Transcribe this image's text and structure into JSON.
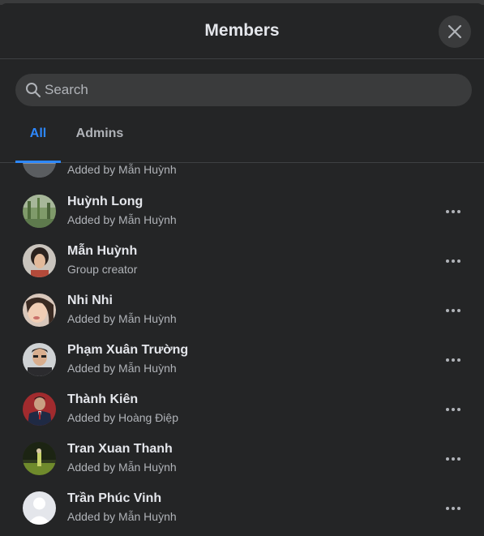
{
  "dialog": {
    "title": "Members"
  },
  "search": {
    "placeholder": "Search"
  },
  "tabs": [
    {
      "label": "All",
      "active": true
    },
    {
      "label": "Admins",
      "active": false
    }
  ],
  "members": [
    {
      "name": "",
      "subtitle": "Added by Mẫn Huỳnh"
    },
    {
      "name": "Huỳnh Long",
      "subtitle": "Added by Mẫn Huỳnh"
    },
    {
      "name": "Mẫn Huỳnh",
      "subtitle": "Group creator"
    },
    {
      "name": "Nhi Nhi",
      "subtitle": "Added by Mẫn Huỳnh"
    },
    {
      "name": "Phạm Xuân Trường",
      "subtitle": "Added by Mẫn Huỳnh"
    },
    {
      "name": "Thành Kiên",
      "subtitle": "Added by Hoàng Điệp"
    },
    {
      "name": "Tran Xuan Thanh",
      "subtitle": "Added by Mẫn Huỳnh"
    },
    {
      "name": "Trần Phúc Vinh",
      "subtitle": "Added by Mẫn Huỳnh"
    }
  ],
  "colors": {
    "background": "#242526",
    "accent": "#2d88ff",
    "surface": "#3a3b3c",
    "text_primary": "#e4e6eb",
    "text_secondary": "#b0b3b8"
  },
  "icons": {
    "close": "close-icon",
    "search": "search-icon",
    "more": "more-options-icon",
    "default_avatar": "default-avatar-icon"
  }
}
